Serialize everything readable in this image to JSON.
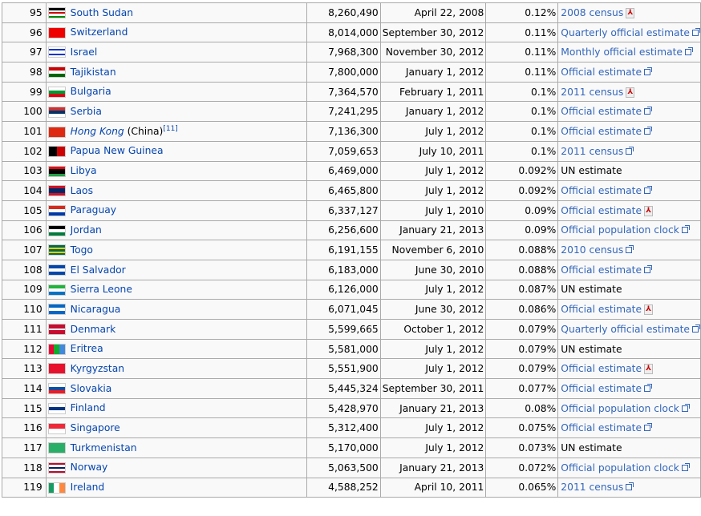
{
  "rows": [
    {
      "rank": "95",
      "country": "South Sudan",
      "flag": {
        "dir": "h",
        "colors": [
          "#000",
          "#fff",
          "#c00",
          "#fff",
          "#080"
        ]
      },
      "population": "8,260,490",
      "date": "April 22, 2008",
      "percent": "0.12%",
      "source": "2008 census",
      "source_icon": "pdf-icon"
    },
    {
      "rank": "96",
      "country": "Switzerland",
      "flag": {
        "dir": "h",
        "colors": [
          "#e00"
        ]
      },
      "population": "8,014,000",
      "date": "September 30, 2012",
      "percent": "0.11%",
      "source": "Quarterly official estimate",
      "source_icon": "external-link-icon"
    },
    {
      "rank": "97",
      "country": "Israel",
      "flag": {
        "dir": "h",
        "colors": [
          "#fff",
          "#03c",
          "#fff",
          "#fff",
          "#03c",
          "#fff"
        ]
      },
      "population": "7,968,300",
      "date": "November 30, 2012",
      "percent": "0.11%",
      "source": "Monthly official estimate",
      "source_icon": "external-link-icon"
    },
    {
      "rank": "98",
      "country": "Tajikistan",
      "flag": {
        "dir": "h",
        "colors": [
          "#c00",
          "#fff",
          "#060"
        ]
      },
      "population": "7,800,000",
      "date": "January 1, 2012",
      "percent": "0.11%",
      "source": "Official estimate",
      "source_icon": "external-link-icon"
    },
    {
      "rank": "99",
      "country": "Bulgaria",
      "flag": {
        "dir": "h",
        "colors": [
          "#fff",
          "#093",
          "#d01"
        ]
      },
      "population": "7,364,570",
      "date": "February 1, 2011",
      "percent": "0.1%",
      "source": "2011 census",
      "source_icon": "pdf-icon"
    },
    {
      "rank": "100",
      "country": "Serbia",
      "flag": {
        "dir": "h",
        "colors": [
          "#c33",
          "#036",
          "#fff"
        ]
      },
      "population": "7,241,295",
      "date": "January 1, 2012",
      "percent": "0.1%",
      "source": "Official estimate",
      "source_icon": "external-link-icon"
    },
    {
      "rank": "101",
      "country": "Hong Kong",
      "country_suffix": " (China)",
      "note": "[11]",
      "italic": true,
      "flag": {
        "dir": "h",
        "colors": [
          "#de2910"
        ]
      },
      "population": "7,136,300",
      "date": "July 1, 2012",
      "percent": "0.1%",
      "source": "Official estimate",
      "source_icon": "external-link-icon"
    },
    {
      "rank": "102",
      "country": "Papua New Guinea",
      "flag": {
        "dir": "v",
        "colors": [
          "#000",
          "#c00"
        ]
      },
      "population": "7,059,653",
      "date": "July 10, 2011",
      "percent": "0.1%",
      "source": "2011 census",
      "source_icon": "external-link-icon"
    },
    {
      "rank": "103",
      "country": "Libya",
      "flag": {
        "dir": "h",
        "colors": [
          "#e70013",
          "#000",
          "#000",
          "#239e46"
        ]
      },
      "population": "6,469,000",
      "date": "July 1, 2012",
      "percent": "0.092%",
      "source": "UN estimate",
      "source_icon": ""
    },
    {
      "rank": "104",
      "country": "Laos",
      "flag": {
        "dir": "h",
        "colors": [
          "#ce1126",
          "#002868",
          "#002868",
          "#ce1126"
        ]
      },
      "population": "6,465,800",
      "date": "July 1, 2012",
      "percent": "0.092%",
      "source": "Official estimate",
      "source_icon": "external-link-icon"
    },
    {
      "rank": "105",
      "country": "Paraguay",
      "flag": {
        "dir": "h",
        "colors": [
          "#d52b1e",
          "#fff",
          "#0038a8"
        ]
      },
      "population": "6,337,127",
      "date": "July 1, 2010",
      "percent": "0.09%",
      "source": "Official estimate",
      "source_icon": "pdf-icon"
    },
    {
      "rank": "106",
      "country": "Jordan",
      "flag": {
        "dir": "h",
        "colors": [
          "#000",
          "#fff",
          "#007a3d"
        ]
      },
      "population": "6,256,600",
      "date": "January 21, 2013",
      "percent": "0.09%",
      "source": "Official population clock",
      "source_icon": "external-link-icon"
    },
    {
      "rank": "107",
      "country": "Togo",
      "flag": {
        "dir": "h",
        "colors": [
          "#006a4e",
          "#ffce00",
          "#006a4e",
          "#ffce00",
          "#006a4e"
        ]
      },
      "population": "6,191,155",
      "date": "November 6, 2010",
      "percent": "0.088%",
      "source": "2010 census",
      "source_icon": "external-link-icon"
    },
    {
      "rank": "108",
      "country": "El Salvador",
      "flag": {
        "dir": "h",
        "colors": [
          "#0047ab",
          "#fff",
          "#0047ab"
        ]
      },
      "population": "6,183,000",
      "date": "June 30, 2010",
      "percent": "0.088%",
      "source": "Official estimate",
      "source_icon": "external-link-icon"
    },
    {
      "rank": "109",
      "country": "Sierra Leone",
      "flag": {
        "dir": "h",
        "colors": [
          "#1eb53a",
          "#fff",
          "#0072c6"
        ]
      },
      "population": "6,126,000",
      "date": "July 1, 2012",
      "percent": "0.087%",
      "source": "UN estimate",
      "source_icon": ""
    },
    {
      "rank": "110",
      "country": "Nicaragua",
      "flag": {
        "dir": "h",
        "colors": [
          "#0067c6",
          "#fff",
          "#0067c6"
        ]
      },
      "population": "6,071,045",
      "date": "June 30, 2012",
      "percent": "0.086%",
      "source": "Official estimate",
      "source_icon": "pdf-icon"
    },
    {
      "rank": "111",
      "country": "Denmark",
      "flag": {
        "dir": "h",
        "colors": [
          "#c60c30",
          "#c60c30",
          "#fff",
          "#c60c30",
          "#c60c30"
        ]
      },
      "population": "5,599,665",
      "date": "October 1, 2012",
      "percent": "0.079%",
      "source": "Quarterly official estimate",
      "source_icon": "external-link-icon"
    },
    {
      "rank": "112",
      "country": "Eritrea",
      "flag": {
        "dir": "v",
        "colors": [
          "#ea0437",
          "#12ad2b",
          "#4189dd"
        ]
      },
      "population": "5,581,000",
      "date": "July 1, 2012",
      "percent": "0.079%",
      "source": "UN estimate",
      "source_icon": ""
    },
    {
      "rank": "113",
      "country": "Kyrgyzstan",
      "flag": {
        "dir": "h",
        "colors": [
          "#e8112d"
        ]
      },
      "population": "5,551,900",
      "date": "July 1, 2012",
      "percent": "0.079%",
      "source": "Official estimate",
      "source_icon": "pdf-icon"
    },
    {
      "rank": "114",
      "country": "Slovakia",
      "flag": {
        "dir": "h",
        "colors": [
          "#fff",
          "#0b4ea2",
          "#ee1c25"
        ]
      },
      "population": "5,445,324",
      "date": "September 30, 2011",
      "percent": "0.077%",
      "source": "Official estimate",
      "source_icon": "external-link-icon"
    },
    {
      "rank": "115",
      "country": "Finland",
      "flag": {
        "dir": "h",
        "colors": [
          "#fff",
          "#003580",
          "#fff"
        ]
      },
      "population": "5,428,970",
      "date": "January 21, 2013",
      "percent": "0.08%",
      "source": "Official population clock",
      "source_icon": "external-link-icon"
    },
    {
      "rank": "116",
      "country": "Singapore",
      "flag": {
        "dir": "h",
        "colors": [
          "#ed2939",
          "#fff"
        ]
      },
      "population": "5,312,400",
      "date": "July 1, 2012",
      "percent": "0.075%",
      "source": "Official estimate",
      "source_icon": "external-link-icon"
    },
    {
      "rank": "117",
      "country": "Turkmenistan",
      "flag": {
        "dir": "h",
        "colors": [
          "#28ae66"
        ]
      },
      "population": "5,170,000",
      "date": "July 1, 2012",
      "percent": "0.073%",
      "source": "UN estimate",
      "source_icon": ""
    },
    {
      "rank": "118",
      "country": "Norway",
      "flag": {
        "dir": "h",
        "colors": [
          "#ba0c2f",
          "#fff",
          "#00205b",
          "#fff",
          "#ba0c2f"
        ]
      },
      "population": "5,063,500",
      "date": "January 21, 2013",
      "percent": "0.072%",
      "source": "Official population clock",
      "source_icon": "external-link-icon"
    },
    {
      "rank": "119",
      "country": "Ireland",
      "flag": {
        "dir": "v",
        "colors": [
          "#169b62",
          "#fff",
          "#ff883e"
        ]
      },
      "population": "4,588,252",
      "date": "April 10, 2011",
      "percent": "0.065%",
      "source": "2011 census",
      "source_icon": "external-link-icon"
    }
  ]
}
